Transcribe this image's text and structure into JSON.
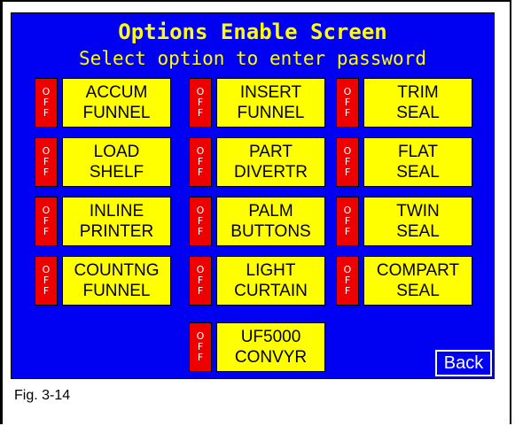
{
  "screen": {
    "title": "Options Enable Screen",
    "subtitle": "Select option to enter password",
    "back_label": "Back"
  },
  "caption": "Fig. 3-14",
  "status_letters": [
    "O",
    "F",
    "F"
  ],
  "options": [
    {
      "line1": "ACCUM",
      "line2": "FUNNEL"
    },
    {
      "line1": "INSERT",
      "line2": "FUNNEL"
    },
    {
      "line1": "TRIM",
      "line2": "SEAL"
    },
    {
      "line1": "LOAD",
      "line2": "SHELF"
    },
    {
      "line1": "PART",
      "line2": "DIVERTR"
    },
    {
      "line1": "FLAT",
      "line2": "SEAL"
    },
    {
      "line1": "INLINE",
      "line2": "PRINTER"
    },
    {
      "line1": "PALM",
      "line2": "BUTTONS"
    },
    {
      "line1": "TWIN",
      "line2": "SEAL"
    },
    {
      "line1": "COUNTNG",
      "line2": "FUNNEL"
    },
    {
      "line1": "LIGHT",
      "line2": "CURTAIN"
    },
    {
      "line1": "COMPART",
      "line2": "SEAL"
    },
    {
      "line1": "UF5000",
      "line2": "CONVYR"
    }
  ],
  "colors": {
    "screen_bg": "#0000f2",
    "title_text": "#ffff00",
    "option_button": "#ffff00",
    "status_indicator": "#ee0000",
    "back_border": "#ffffff"
  }
}
